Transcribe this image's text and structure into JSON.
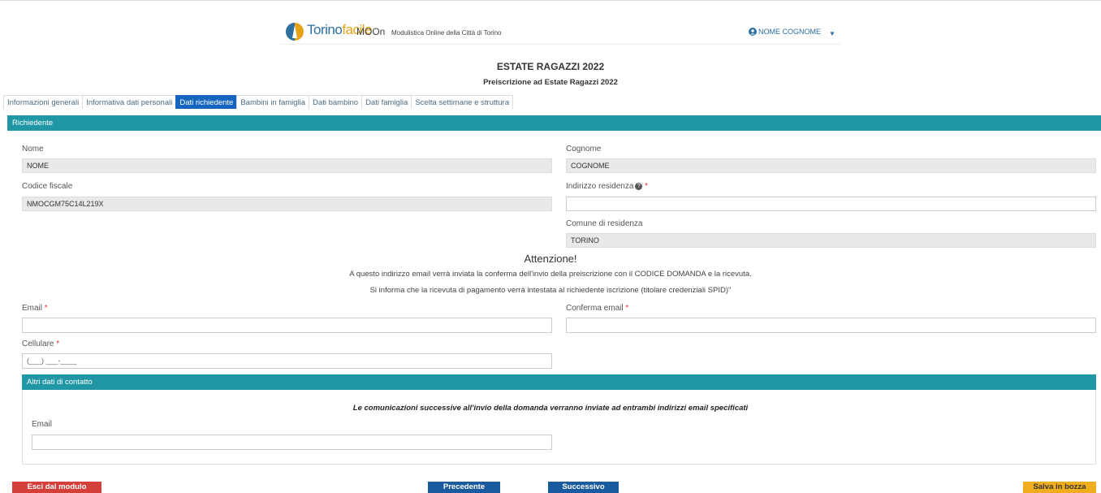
{
  "header": {
    "logo_part1": "Torino",
    "logo_part2": "facile",
    "app_name": "MOOn",
    "app_subtitle": "Modulistica Online della Città di Torino",
    "user_name": "NOME COGNOME",
    "user_icon": "user-circle-icon",
    "caret_icon": "caret-down-icon"
  },
  "page": {
    "title": "ESTATE RAGAZZI 2022",
    "subtitle": "Preiscrizione ad Estate Ragazzi 2022"
  },
  "tabs": [
    {
      "label": "Informazioni generali",
      "active": false
    },
    {
      "label": "Informativa dati personali",
      "active": false
    },
    {
      "label": "Dati richiedente",
      "active": true
    },
    {
      "label": "Bambini in famiglia",
      "active": false
    },
    {
      "label": "Dati bambino",
      "active": false
    },
    {
      "label": "Dati famiglia",
      "active": false
    },
    {
      "label": "Scelta settimane e struttura",
      "active": false
    }
  ],
  "section": {
    "title": "Richiedente",
    "nome_label": "Nome",
    "nome_value": "NOME",
    "cognome_label": "Cognome",
    "cognome_value": "COGNOME",
    "cf_label": "Codice fiscale",
    "cf_value": "NMOCGM75C14L219X",
    "indirizzo_label": "Indirizzo residenza",
    "indirizzo_value": "",
    "comune_label": "Comune di residenza",
    "comune_value": "TORINO",
    "required_mark": "*"
  },
  "attention": {
    "heading": "Attenzione!",
    "line1": "A questo indirizzo email verrà inviata la conferma dell'invio della preiscrizione con il CODICE DOMANDA e la ricevuta.",
    "line2": "Si informa che la ricevuta di pagamento verrà intestata al richiedente iscrizione (titolare credenziali SPID)\""
  },
  "contact": {
    "email_label": "Email",
    "email_value": "",
    "confirm_label": "Conferma email",
    "confirm_value": "",
    "cell_label": "Cellulare",
    "cell_placeholder": "(___) ___-____"
  },
  "altri": {
    "title": "Altri dati di contatto",
    "note": "Le comunicazioni successive all'invio della domanda verranno inviate ad entrambi indirizzi email specificati",
    "email_label": "Email",
    "email_value": ""
  },
  "buttons": {
    "exit": "Esci dal modulo",
    "prev": "Precedente",
    "next": "Successivo",
    "save": "Salva in bozza"
  },
  "colors": {
    "teal": "#2197a6",
    "blue": "#1565c0",
    "exit_red": "#d43f3a",
    "nav_blue": "#1a5a9e",
    "save_yellow": "#f0ad1e"
  }
}
